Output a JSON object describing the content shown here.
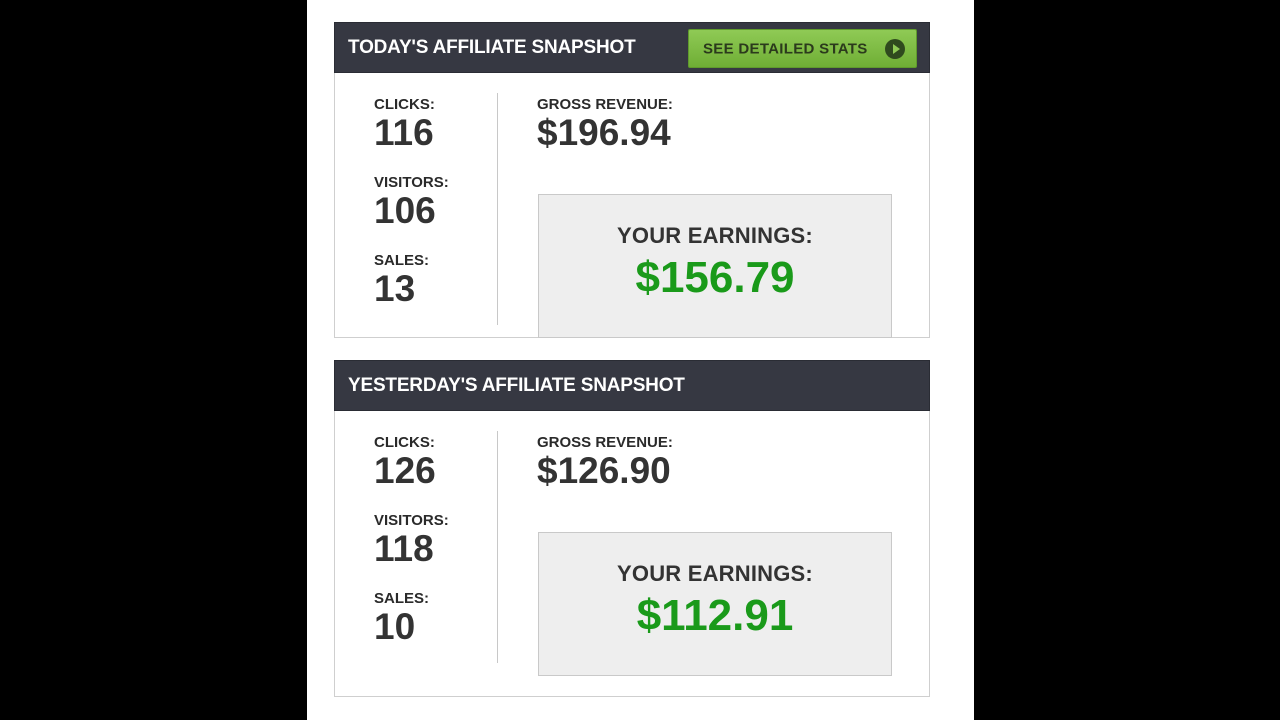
{
  "today": {
    "title": "TODAY'S AFFILIATE SNAPSHOT",
    "button_label": "SEE DETAILED STATS",
    "clicks_label": "CLICKS:",
    "clicks": "116",
    "visitors_label": "VISITORS:",
    "visitors": "106",
    "sales_label": "SALES:",
    "sales": "13",
    "gross_revenue_label": "GROSS REVENUE:",
    "gross_revenue": "$196.94",
    "earnings_label": "YOUR EARNINGS:",
    "earnings": "$156.79"
  },
  "yesterday": {
    "title": "YESTERDAY'S AFFILIATE SNAPSHOT",
    "clicks_label": "CLICKS:",
    "clicks": "126",
    "visitors_label": "VISITORS:",
    "visitors": "118",
    "sales_label": "SALES:",
    "sales": "10",
    "gross_revenue_label": "GROSS REVENUE:",
    "gross_revenue": "$126.90",
    "earnings_label": "YOUR EARNINGS:",
    "earnings": "$112.91"
  },
  "colors": {
    "header_bg": "#363842",
    "button_green": "#7bbd43",
    "earnings_green": "#1a9a1a",
    "earnings_box_bg": "#eeeeee"
  },
  "icons": {
    "button_icon": "play-circle-icon"
  }
}
